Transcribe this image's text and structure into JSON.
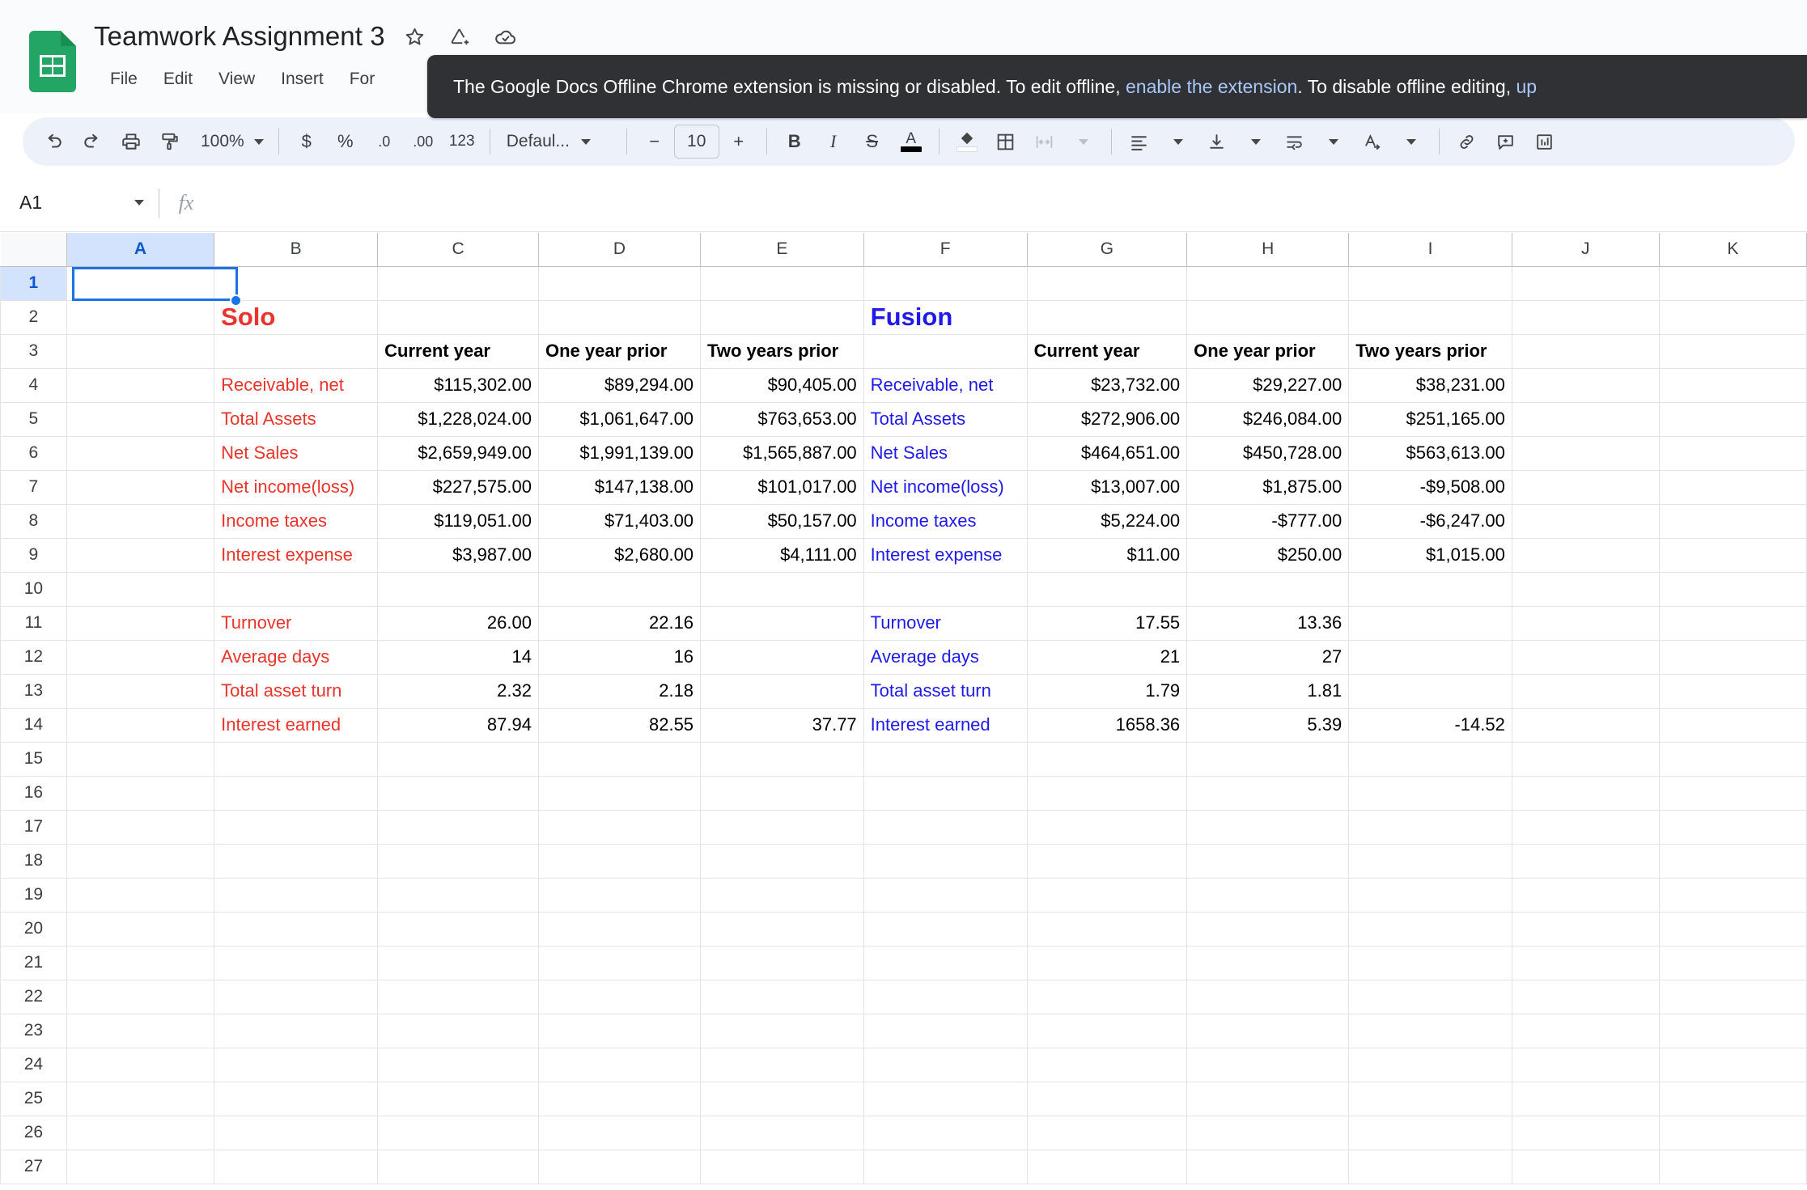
{
  "app": {
    "doc_title": "Teamwork Assignment 3",
    "logo_name": "google-sheets-logo"
  },
  "title_icons": [
    {
      "name": "star-icon",
      "glyph": "☆"
    },
    {
      "name": "move-to-folder-icon",
      "glyph": "△"
    },
    {
      "name": "cloud-saved-icon",
      "glyph": "☁"
    }
  ],
  "menus": [
    "File",
    "Edit",
    "View",
    "Insert",
    "For"
  ],
  "toolbar": {
    "undo": "undo-icon",
    "redo": "redo-icon",
    "print": "print-icon",
    "paint_format": "paint-format-icon",
    "zoom_value": "100%",
    "currency": "$",
    "percent": "%",
    "decrease_decimal": ".0",
    "increase_decimal": ".00",
    "more_formats": "123",
    "font_name": "Defaul...",
    "font_decrease": "−",
    "font_size": "10",
    "font_increase": "+",
    "bold": "B",
    "italic": "I",
    "strikethrough": "S",
    "text_color": "A",
    "fill_color": "fill-color-icon",
    "borders": "borders-icon",
    "merge_cells": "merge-cells-icon",
    "horizontal_align": "horizontal-align-icon",
    "vertical_align": "vertical-align-icon",
    "text_wrap": "text-wrap-icon",
    "text_rotation": "text-rotation-icon",
    "insert_link": "insert-link-icon",
    "insert_comment": "insert-comment-icon",
    "insert_chart": "insert-chart-icon"
  },
  "banner": {
    "text_before_link": "The Google Docs Offline Chrome extension is missing or disabled. To edit offline,",
    "link1": "enable the extension",
    "text_middle": ". To disable offline editing,",
    "link2": "up"
  },
  "formula_bar": {
    "name_box": "A1",
    "fx_label": "fx",
    "formula_value": ""
  },
  "grid": {
    "columns": [
      "A",
      "B",
      "C",
      "D",
      "E",
      "F",
      "G",
      "H",
      "I",
      "J",
      "K"
    ],
    "selected_column": "A",
    "selected_row": "1",
    "selected_cell": "A1",
    "row_count": 27
  },
  "chart_data": {
    "type": "table",
    "title": "Teamwork Assignment 3 — Solo vs Fusion financial comparison",
    "companies": [
      {
        "name": "Solo",
        "color": "#e8342a",
        "name_cell": "B2",
        "label_column": "B",
        "value_columns": [
          "C",
          "D",
          "E"
        ],
        "headers": [
          "Current year",
          "One year prior",
          "Two years prior"
        ],
        "rows": [
          {
            "row": 4,
            "label": "Receivable, net",
            "values": [
              "$115,302.00",
              "$89,294.00",
              "$90,405.00"
            ]
          },
          {
            "row": 5,
            "label": "Total Assets",
            "values": [
              "$1,228,024.00",
              "$1,061,647.00",
              "$763,653.00"
            ]
          },
          {
            "row": 6,
            "label": "Net Sales",
            "values": [
              "$2,659,949.00",
              "$1,991,139.00",
              "$1,565,887.00"
            ]
          },
          {
            "row": 7,
            "label": "Net income(loss)",
            "values": [
              "$227,575.00",
              "$147,138.00",
              "$101,017.00"
            ]
          },
          {
            "row": 8,
            "label": "Income taxes",
            "values": [
              "$119,051.00",
              "$71,403.00",
              "$50,157.00"
            ]
          },
          {
            "row": 9,
            "label": "Interest expense",
            "values": [
              "$3,987.00",
              "$2,680.00",
              "$4,111.00"
            ]
          },
          {
            "row": 11,
            "label": "Turnover",
            "values": [
              "26.00",
              "22.16",
              ""
            ]
          },
          {
            "row": 12,
            "label": "Average days",
            "values": [
              "14",
              "16",
              ""
            ]
          },
          {
            "row": 13,
            "label": "Total asset turn",
            "values": [
              "2.32",
              "2.18",
              ""
            ]
          },
          {
            "row": 14,
            "label": "Interest earned",
            "values": [
              "87.94",
              "82.55",
              "37.77"
            ]
          }
        ]
      },
      {
        "name": "Fusion",
        "color": "#1f1ae8",
        "name_cell": "F2",
        "label_column": "F",
        "value_columns": [
          "G",
          "H",
          "I"
        ],
        "headers": [
          "Current year",
          "One year prior",
          "Two years prior"
        ],
        "rows": [
          {
            "row": 4,
            "label": "Receivable, net",
            "values": [
              "$23,732.00",
              "$29,227.00",
              "$38,231.00"
            ]
          },
          {
            "row": 5,
            "label": "Total Assets",
            "values": [
              "$272,906.00",
              "$246,084.00",
              "$251,165.00"
            ]
          },
          {
            "row": 6,
            "label": "Net Sales",
            "values": [
              "$464,651.00",
              "$450,728.00",
              "$563,613.00"
            ]
          },
          {
            "row": 7,
            "label": "Net income(loss)",
            "values": [
              "$13,007.00",
              "$1,875.00",
              "-$9,508.00"
            ]
          },
          {
            "row": 8,
            "label": "Income taxes",
            "values": [
              "$5,224.00",
              "-$777.00",
              "-$6,247.00"
            ]
          },
          {
            "row": 9,
            "label": "Interest expense",
            "values": [
              "$11.00",
              "$250.00",
              "$1,015.00"
            ]
          },
          {
            "row": 11,
            "label": "Turnover",
            "values": [
              "17.55",
              "13.36",
              ""
            ]
          },
          {
            "row": 12,
            "label": "Average days",
            "values": [
              "21",
              "27",
              ""
            ]
          },
          {
            "row": 13,
            "label": "Total asset turn",
            "values": [
              "1.79",
              "1.81",
              ""
            ]
          },
          {
            "row": 14,
            "label": "Interest earned",
            "values": [
              "1658.36",
              "5.39",
              "-14.52"
            ]
          }
        ]
      }
    ]
  },
  "colors": {
    "solo_red": "#e8342a",
    "fusion_blue": "#1f1ae8",
    "selection_blue": "#1a73e8",
    "header_selected_bg": "#d3e3fd",
    "toolbar_bg": "#edf2fa",
    "banner_bg": "#303134",
    "banner_link": "#a8c7fa"
  }
}
